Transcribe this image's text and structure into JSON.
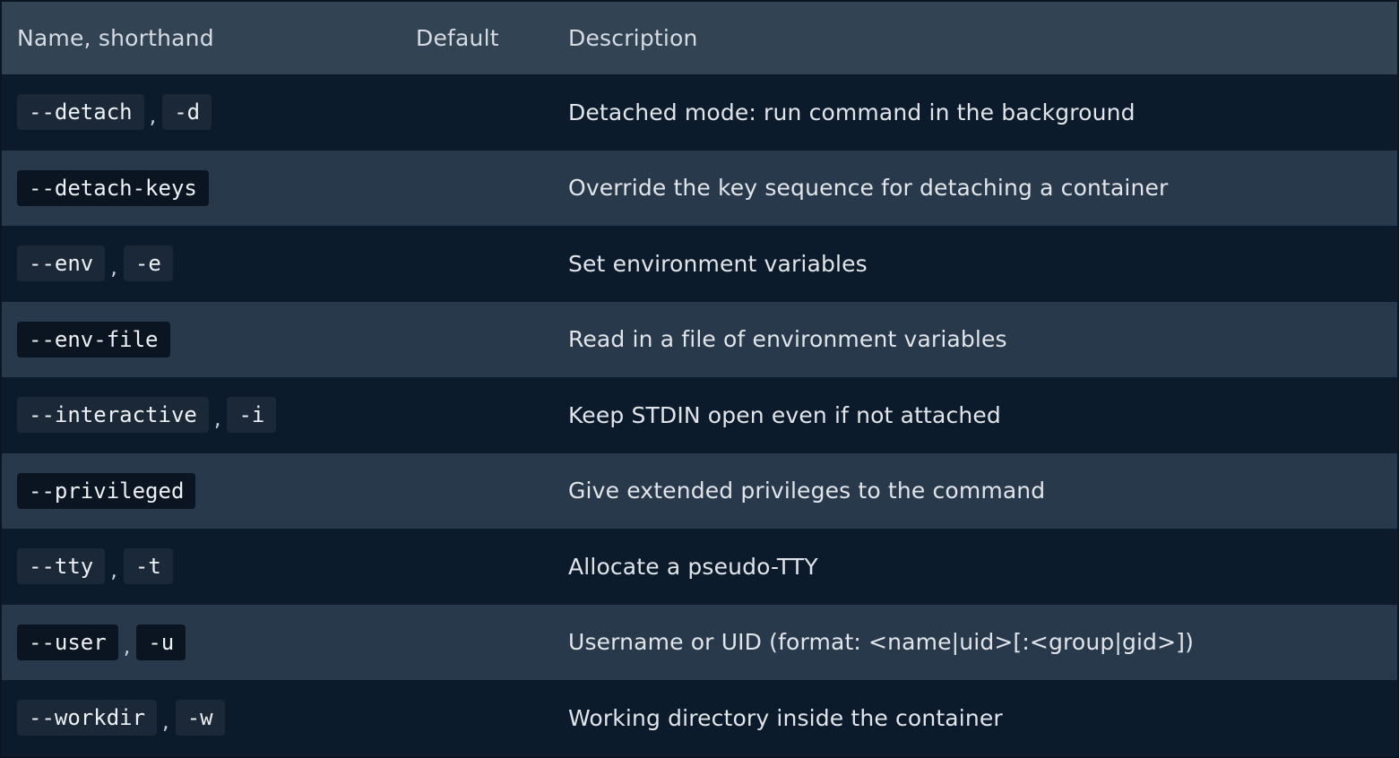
{
  "table": {
    "headers": {
      "name": "Name, shorthand",
      "default": "Default",
      "description": "Description"
    },
    "rows": [
      {
        "flag": "--detach",
        "short": "-d",
        "default": "",
        "description": "Detached mode: run command in the background"
      },
      {
        "flag": "--detach-keys",
        "short": "",
        "default": "",
        "description": "Override the key sequence for detaching a container"
      },
      {
        "flag": "--env",
        "short": "-e",
        "default": "",
        "description": "Set environment variables"
      },
      {
        "flag": "--env-file",
        "short": "",
        "default": "",
        "description": "Read in a file of environment variables"
      },
      {
        "flag": "--interactive",
        "short": "-i",
        "default": "",
        "description": "Keep STDIN open even if not attached"
      },
      {
        "flag": "--privileged",
        "short": "",
        "default": "",
        "description": "Give extended privileges to the command"
      },
      {
        "flag": "--tty",
        "short": "-t",
        "default": "",
        "description": "Allocate a pseudo-TTY"
      },
      {
        "flag": "--user",
        "short": "-u",
        "default": "",
        "description": "Username or UID (format: <name|uid>[:<group|gid>])"
      },
      {
        "flag": "--workdir",
        "short": "-w",
        "default": "",
        "description": "Working directory inside the container"
      }
    ],
    "separator": ","
  },
  "colors": {
    "header_bg": "#324454",
    "row_dark_bg": "#0c1b2b",
    "row_light_bg": "#27394a",
    "text": "#e1e5ea"
  }
}
